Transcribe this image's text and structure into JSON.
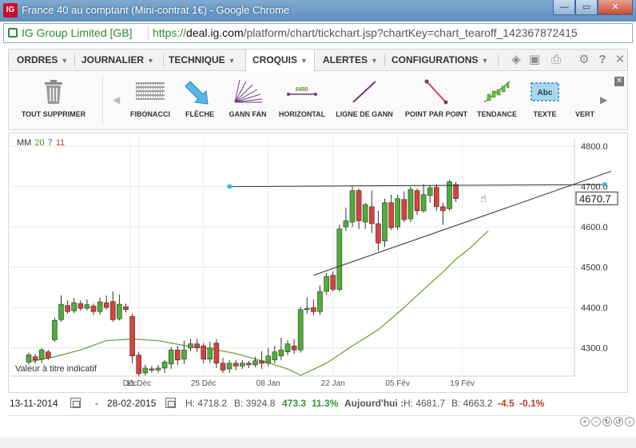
{
  "window": {
    "title": "France 40 au comptant (Mini-contrat 1€) - Google Chrome",
    "app_icon_text": "IG",
    "min_label": "—",
    "max_label": "▭",
    "close_label": "✕"
  },
  "address_bar": {
    "ev_label": "IG Group Limited [GB]",
    "scheme": "https://",
    "host": "deal.ig.com",
    "path": "/platform/chart/tickchart.jsp?chartKey=chart_tearoff_142367872415"
  },
  "menu": {
    "items": [
      "ORDRES",
      "JOURNALIER",
      "TECHNIQUE",
      "CROQUIS",
      "ALERTES",
      "CONFIGURATIONS"
    ],
    "active": "CROQUIS",
    "arrow": "▼",
    "right_icons": [
      "layers-icon",
      "image-icon",
      "print-icon",
      "gear-icon",
      "help-icon",
      "close-icon"
    ]
  },
  "toolbar": {
    "delete_all": "TOUT SUPPRIMER",
    "tools": [
      "FIBONACCI",
      "FLÈCHE",
      "GANN FAN",
      "HORIZONTAL",
      "LIGNE DE GANN",
      "POINT PAR POINT",
      "TENDANCE",
      "TEXTE",
      "VERT"
    ],
    "horizontal_sample": "6450",
    "text_sample": "Abc",
    "scroll_left": "◀",
    "scroll_right": "▶",
    "close": "✕"
  },
  "chart": {
    "legend_label": "MM",
    "legend_values": [
      "20",
      "7",
      "11"
    ],
    "indicative_text": "Valeur à titre indicatif",
    "current_price": "4670.7",
    "cursor_glyph": "☝"
  },
  "chart_data": {
    "type": "candlestick",
    "y_ticks": [
      "4800.0",
      "4700.0",
      "4600.0",
      "4500.0",
      "4400.0",
      "4300.0"
    ],
    "ylim": [
      4230,
      4820
    ],
    "x_labels": [
      "Déc",
      "11 Déc",
      "25 Déc",
      "08 Jan",
      "22 Jan",
      "05 Fév",
      "19 Fév"
    ],
    "x_label_index": [
      7,
      17,
      27,
      37,
      47,
      57,
      67
    ],
    "candles": [
      [
        4265,
        4283,
        4255,
        4288
      ],
      [
        4278,
        4270,
        4262,
        4285
      ],
      [
        4272,
        4295,
        4262,
        4300
      ],
      [
        4290,
        4275,
        4270,
        4295
      ],
      [
        4320,
        4368,
        4315,
        4375
      ],
      [
        4370,
        4408,
        4365,
        4430
      ],
      [
        4405,
        4390,
        4385,
        4418
      ],
      [
        4392,
        4412,
        4386,
        4424
      ],
      [
        4410,
        4398,
        4392,
        4418
      ],
      [
        4398,
        4407,
        4393,
        4420
      ],
      [
        4404,
        4390,
        4382,
        4410
      ],
      [
        4390,
        4414,
        4382,
        4425
      ],
      [
        4412,
        4400,
        4395,
        4430
      ],
      [
        4415,
        4370,
        4365,
        4440
      ],
      [
        4372,
        4408,
        4368,
        4432
      ],
      [
        4402,
        4395,
        4388,
        4410
      ],
      [
        4378,
        4280,
        4262,
        4385
      ],
      [
        4282,
        4236,
        4228,
        4290
      ],
      [
        4238,
        4250,
        4232,
        4258
      ],
      [
        4248,
        4245,
        4238,
        4255
      ],
      [
        4245,
        4250,
        4238,
        4258
      ],
      [
        4250,
        4265,
        4238,
        4270
      ],
      [
        4260,
        4295,
        4248,
        4302
      ],
      [
        4295,
        4270,
        4258,
        4305
      ],
      [
        4272,
        4295,
        4260,
        4318
      ],
      [
        4300,
        4310,
        4292,
        4322
      ],
      [
        4310,
        4300,
        4290,
        4322
      ],
      [
        4305,
        4272,
        4262,
        4312
      ],
      [
        4272,
        4300,
        4262,
        4315
      ],
      [
        4312,
        4262,
        4250,
        4322
      ],
      [
        4262,
        4245,
        4238,
        4275
      ],
      [
        4248,
        4262,
        4238,
        4270
      ],
      [
        4262,
        4255,
        4245,
        4270
      ],
      [
        4255,
        4262,
        4248,
        4270
      ],
      [
        4262,
        4258,
        4250,
        4268
      ],
      [
        4258,
        4268,
        4252,
        4278
      ],
      [
        4268,
        4262,
        4248,
        4292
      ],
      [
        4262,
        4280,
        4255,
        4300
      ],
      [
        4270,
        4290,
        4262,
        4305
      ],
      [
        4280,
        4295,
        4270,
        4325
      ],
      [
        4290,
        4310,
        4282,
        4318
      ],
      [
        4305,
        4295,
        4286,
        4322
      ],
      [
        4295,
        4395,
        4288,
        4402
      ],
      [
        4395,
        4398,
        4385,
        4425
      ],
      [
        4400,
        4390,
        4380,
        4420
      ],
      [
        4390,
        4440,
        4382,
        4455
      ],
      [
        4440,
        4477,
        4432,
        4485
      ],
      [
        4480,
        4445,
        4440,
        4490
      ],
      [
        4445,
        4595,
        4440,
        4605
      ],
      [
        4600,
        4615,
        4590,
        4648
      ],
      [
        4612,
        4690,
        4600,
        4700
      ],
      [
        4690,
        4615,
        4595,
        4695
      ],
      [
        4612,
        4655,
        4595,
        4660
      ],
      [
        4650,
        4608,
        4585,
        4690
      ],
      [
        4608,
        4560,
        4540,
        4640
      ],
      [
        4565,
        4660,
        4550,
        4670
      ],
      [
        4660,
        4598,
        4592,
        4680
      ],
      [
        4600,
        4670,
        4592,
        4680
      ],
      [
        4668,
        4618,
        4612,
        4688
      ],
      [
        4620,
        4693,
        4612,
        4700
      ],
      [
        4690,
        4640,
        4630,
        4695
      ],
      [
        4640,
        4680,
        4635,
        4706
      ],
      [
        4678,
        4697,
        4660,
        4702
      ],
      [
        4698,
        4650,
        4640,
        4706
      ],
      [
        4650,
        4640,
        4605,
        4660
      ],
      [
        4645,
        4712,
        4640,
        4716
      ],
      [
        4705,
        4670,
        4662,
        4712
      ]
    ],
    "moving_average": [
      [
        0,
        4265
      ],
      [
        4,
        4278
      ],
      [
        8,
        4295
      ],
      [
        12,
        4318
      ],
      [
        16,
        4322
      ],
      [
        20,
        4318
      ],
      [
        24,
        4306
      ],
      [
        28,
        4298
      ],
      [
        32,
        4286
      ],
      [
        36,
        4268
      ],
      [
        40,
        4248
      ],
      [
        42,
        4232
      ],
      [
        46,
        4262
      ],
      [
        50,
        4305
      ],
      [
        54,
        4345
      ],
      [
        58,
        4400
      ],
      [
        61,
        4445
      ],
      [
        64,
        4488
      ],
      [
        66,
        4520
      ],
      [
        68,
        4545
      ],
      [
        70,
        4575
      ],
      [
        71,
        4590
      ]
    ],
    "drawings": {
      "horizontal_line": [
        [
          31,
          4700
        ],
        [
          89,
          4705
        ]
      ],
      "trend_line": [
        [
          44,
          4480
        ],
        [
          90,
          4738
        ]
      ]
    }
  },
  "footer": {
    "date_from": "13-11-2014",
    "dash": "-",
    "date_to": "28-02-2015",
    "h_label": "H: 4718.2",
    "b_label": "B: 3924.8",
    "change": "473.3",
    "change_pct": "11.3%",
    "today_label": "Aujourd'hui :",
    "today_h": "H: 4681.7",
    "today_b": "B: 4663.2",
    "today_change": "-4.5",
    "today_pct": "-0.1%",
    "colors": {
      "up": "#2e9b2e",
      "down": "#c0392b"
    }
  }
}
